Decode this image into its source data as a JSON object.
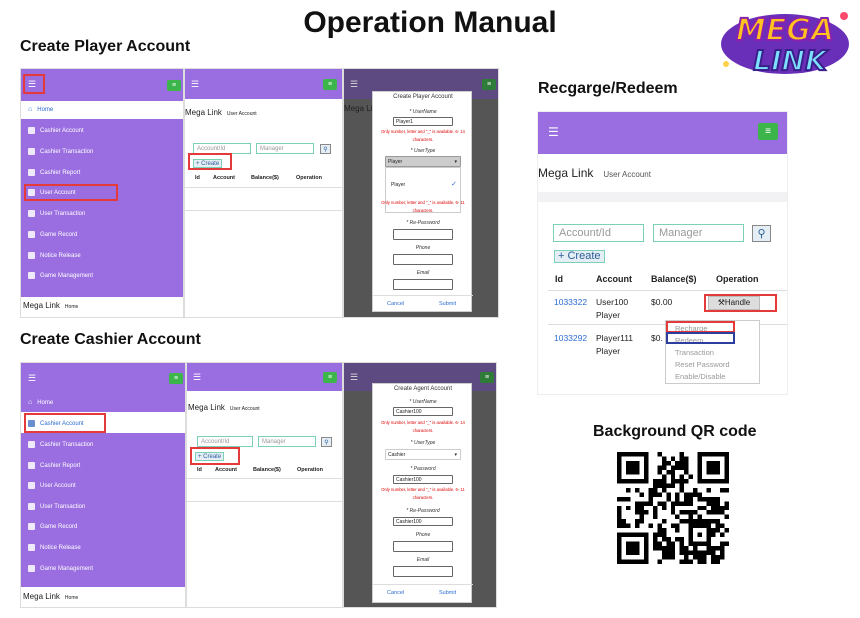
{
  "title": "Operation Manual",
  "logo": {
    "top": "MEGA",
    "bottom": "LINK"
  },
  "sections": {
    "player": "Create Player Account",
    "cashier": "Create Cashier Account",
    "recharge": "Recgarge/Redeem",
    "qr": "Background QR code"
  },
  "menu": {
    "home": "Home",
    "items": [
      "Cashier Account",
      "Cashier Transaction",
      "Cashier Report",
      "User Account",
      "User Transaction",
      "Game Record",
      "Notice Release",
      "Game Management"
    ]
  },
  "crumb": {
    "site": "Mega Link",
    "home": "Home",
    "page": "User Account"
  },
  "search": {
    "account_ph": "Account/Id",
    "manager_ph": "Manager",
    "create": "Create"
  },
  "table": {
    "id": "Id",
    "account": "Account",
    "balance": "Balance($)",
    "operation": "Operation"
  },
  "player_modal": {
    "title": "Create Player Account",
    "username_label": "* UserName",
    "username_value": "Player1",
    "hint1": "Only number, letter and \"_\" is available. 6- 14",
    "hint1b": "characters.",
    "usertype_label": "* UserType",
    "usertype_value": "Player",
    "option": "Player",
    "hint2": "Only number, letter and \"_\" is available. 6- 11",
    "hint2b": "characters.",
    "repassword_label": "* Re-Password",
    "phone_label": "Phone",
    "email_label": "Email",
    "cancel": "Cancel",
    "submit": "Submit"
  },
  "agent_modal": {
    "title": "Create Agent Account",
    "username_label": "* UserName",
    "username_value": "Cashier100",
    "hint1": "Only number, letter and \"_\" is available. 6- 14",
    "hint1b": "characters.",
    "usertype_label": "* UserType",
    "usertype_value": "Cashier",
    "password_label": "* Password",
    "password_value": "Cashier100",
    "hint2": "Only number, letter and \"_\" is available. 6- 11",
    "hint2b": "characters.",
    "repassword_label": "* Re-Password",
    "repassword_value": "Cashier100",
    "phone_label": "Phone",
    "email_label": "Email",
    "cancel": "Cancel",
    "submit": "Submit"
  },
  "recharge_panel": {
    "rows": [
      {
        "id": "1033322",
        "account1": "User100",
        "account2": "Player",
        "balance": "$0.00",
        "op": "Handle"
      },
      {
        "id": "1033292",
        "account1": "Player111",
        "account2": "Player",
        "balance": "$0."
      }
    ],
    "dropdown": [
      "Recharge",
      "Redeem",
      "Transaction",
      "Reset Password",
      "Enable/Disable"
    ]
  },
  "colors": {
    "purple": "#9a6ee0",
    "green": "#3cb54a",
    "red": "#e43a3a",
    "link": "#2b6cd1"
  }
}
